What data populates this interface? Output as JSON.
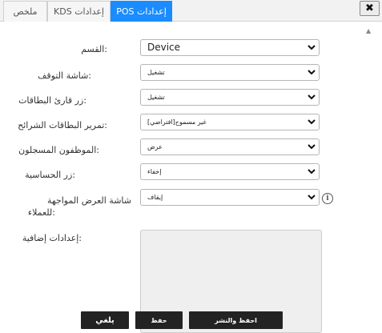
{
  "tabs": {
    "close": "✖",
    "pos": "إعدادات POS",
    "kds": "إعدادات KDS",
    "summary": "ملخص"
  },
  "fields": {
    "department": {
      "label": ":القسم",
      "value": "Device"
    },
    "screensaver": {
      "label": ":شاشة التوقف",
      "value": "تشغيل"
    },
    "card_reader_button": {
      "label": ":زر قارئ البطاقات",
      "value": "تشغيل"
    },
    "card_swipe": {
      "label": ":تمرير البطاقات الشرائح",
      "value": "غير مسموح[افتراضي]"
    },
    "logged_employees": {
      "label": ":الموظفون المسجلون",
      "value": "عرض"
    },
    "sensitivity_button": {
      "label": ":زر الحساسية",
      "value": "إخفاء"
    },
    "customer_display": {
      "label_line1": "شاشة العرض المواجهة",
      "label_line2": ":للعملاء",
      "value": "إيقاف"
    },
    "extra_settings": {
      "label": ":إعدادات إضافية",
      "value": ""
    }
  },
  "icons": {
    "info": "i",
    "scroll_up": "▲"
  },
  "buttons": {
    "cancel": "يلغي",
    "save": "حفظ",
    "save_publish": "احفظ والنشر"
  },
  "colors": {
    "active_tab": "#1a8cff",
    "button_bg": "#232323",
    "textarea_bg": "#efefef"
  }
}
